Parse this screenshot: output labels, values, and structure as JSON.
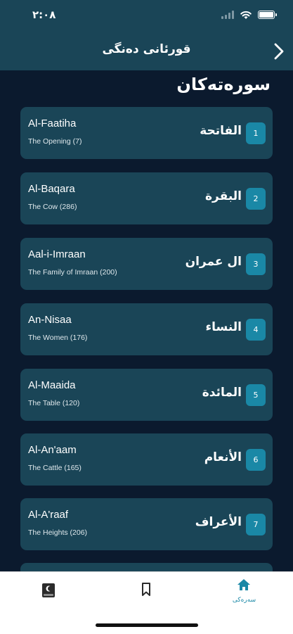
{
  "status": {
    "time": "٢:٠٨"
  },
  "header": {
    "title": "قورئانی دەنگی"
  },
  "section_title": "سورەتەکان",
  "surahs": [
    {
      "number": "1",
      "arabic": "الفاتحة",
      "english": "Al-Faatiha",
      "meaning": "The Opening (7)"
    },
    {
      "number": "2",
      "arabic": "البقرة",
      "english": "Al-Baqara",
      "meaning": "The Cow (286)"
    },
    {
      "number": "3",
      "arabic": "ال عمران",
      "english": "Aal-i-Imraan",
      "meaning": "The Family of Imraan (200)"
    },
    {
      "number": "4",
      "arabic": "النساء",
      "english": "An-Nisaa",
      "meaning": "The Women (176)"
    },
    {
      "number": "5",
      "arabic": "المائدة",
      "english": "Al-Maaida",
      "meaning": "The Table (120)"
    },
    {
      "number": "6",
      "arabic": "الأنعام",
      "english": "Al-An'aam",
      "meaning": "The Cattle (165)"
    },
    {
      "number": "7",
      "arabic": "الأعراف",
      "english": "Al-A'raaf",
      "meaning": "The Heights (206)"
    }
  ],
  "tabbar": {
    "items": [
      {
        "icon": "quran-book-icon"
      },
      {
        "icon": "bookmark-icon"
      },
      {
        "icon": "home-icon",
        "label": "سەرەکی",
        "active": true
      }
    ]
  },
  "colors": {
    "background": "#0b1a2e",
    "header": "#1a4557",
    "card": "#1a4557",
    "accent": "#1a88a6",
    "tabbar": "#ffffff"
  }
}
